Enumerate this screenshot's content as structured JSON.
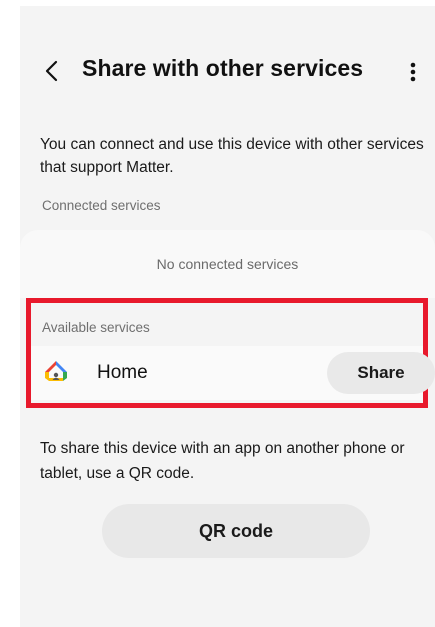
{
  "header": {
    "title": "Share with other services",
    "back_icon": "chevron-left-icon",
    "more_icon": "more-vertical-icon"
  },
  "description": "You can connect and use this device with other services that support Matter.",
  "connected": {
    "label": "Connected services",
    "empty_text": "No connected services"
  },
  "available": {
    "label": "Available services",
    "highlight_color": "#e8192c",
    "services": [
      {
        "name": "Home",
        "icon": "google-home-icon",
        "action_label": "Share"
      }
    ]
  },
  "qr": {
    "description": "To share this device with an app on another phone or tablet, use a QR code.",
    "button_label": "QR code"
  }
}
